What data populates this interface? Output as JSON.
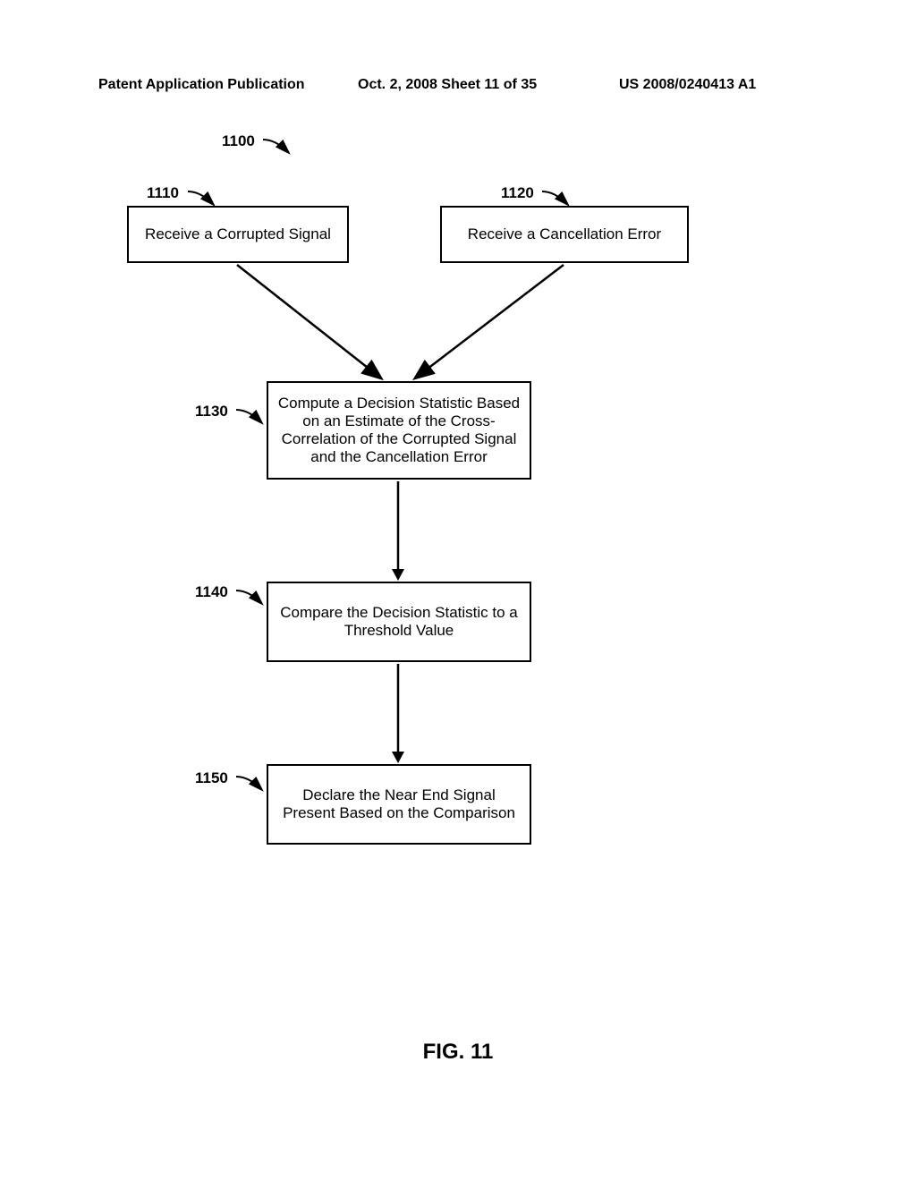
{
  "header": {
    "left": "Patent Application Publication",
    "center": "Oct. 2, 2008   Sheet 11 of 35",
    "right": "US 2008/0240413 A1"
  },
  "labels": {
    "l1100": "1100",
    "l1110": "1110",
    "l1120": "1120",
    "l1130": "1130",
    "l1140": "1140",
    "l1150": "1150"
  },
  "boxes": {
    "b1110": "Receive a Corrupted Signal",
    "b1120": "Receive a Cancellation Error",
    "b1130": "Compute a Decision Statistic Based on an Estimate of the Cross-Correlation of the Corrupted Signal and the Cancellation Error",
    "b1140": "Compare the Decision Statistic to a Threshold Value",
    "b1150": "Declare the Near End Signal Present Based on the Comparison"
  },
  "figure": "FIG. 11"
}
